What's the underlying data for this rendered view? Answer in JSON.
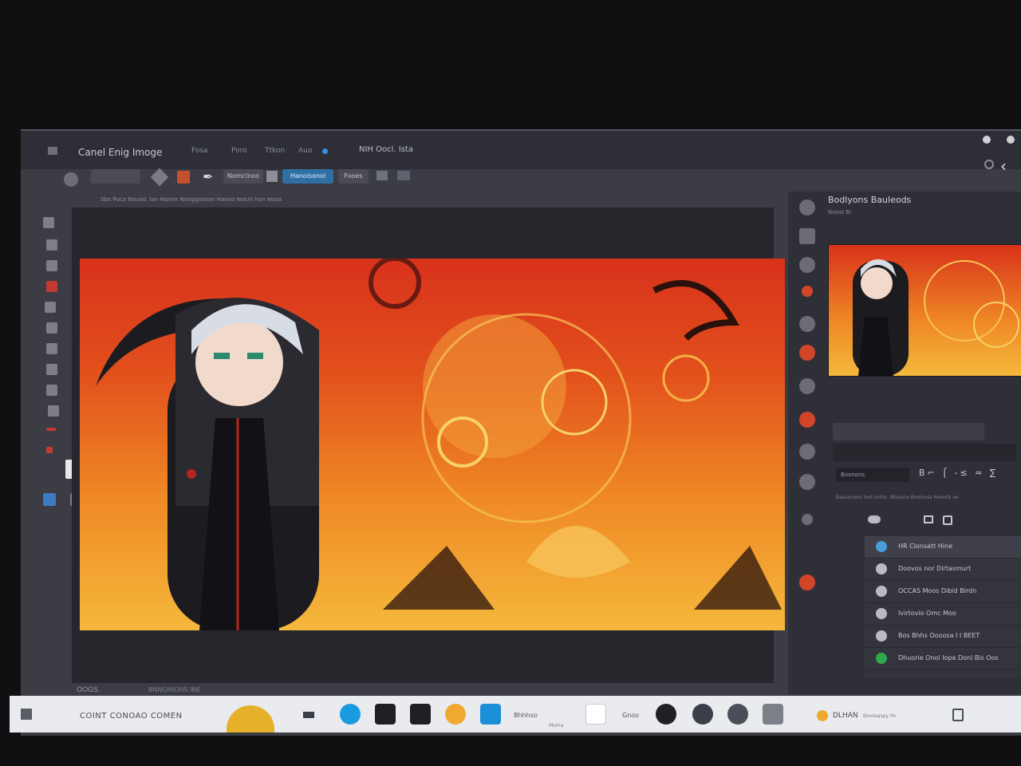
{
  "window": {
    "app_title": "Canel Enig Imoge",
    "menu": [
      "Fosa",
      "Poro",
      "Ttkon",
      "Auo"
    ],
    "doc_title": "NIH Oocl. Ista"
  },
  "toolbar": {
    "button_1": "Nomclnoo",
    "button_2": "Hanoisonol",
    "button_3": "Fooes"
  },
  "options_bar": "Sbo Puca Nound.  Ian Hanne  Nonggoonsn Hanoo Ieocin hon  Iessa",
  "status": {
    "zoom": "OOGS.",
    "info": "BNNOHIOHS INE"
  },
  "right_panel": {
    "title": "Bodlyons Bauleods",
    "subtitle": "Nooal Bi",
    "field_value": "Boonons",
    "char_row": "B⌐ ⌠ -≤ ≈ ∑",
    "note": "Baosonons hod sohin.  Nhosino Boolouss Nooolls oe",
    "layers": [
      {
        "label": "HR Clonsatt Hine",
        "highlight": true
      },
      {
        "label": "Doovos nor Dirtasmurt",
        "highlight": false
      },
      {
        "label": "OCCAS Moos Dibid Birdn",
        "highlight": false
      },
      {
        "label": "Ivirtovio Omc Moo",
        "highlight": false
      },
      {
        "label": "Bos Bhhs Oooosa I I BEET",
        "highlight": false
      },
      {
        "label": "Dhuorie Onoi Iopa Doni Bis Oos",
        "highlight": false
      }
    ]
  },
  "taskbar": {
    "search_text": "COINT CONOAO COMEN",
    "label_1": "Bhhhso",
    "label_2": "Moma",
    "label_3": "Gnoo",
    "end_text": "DLHAN",
    "end_sub": "Biooisaspy Po"
  },
  "colors": {
    "accent": "#2f6fa3",
    "canvas_top": "#d8321b",
    "canvas_bottom": "#f5b83c",
    "taskbar": "#e9ebef"
  }
}
